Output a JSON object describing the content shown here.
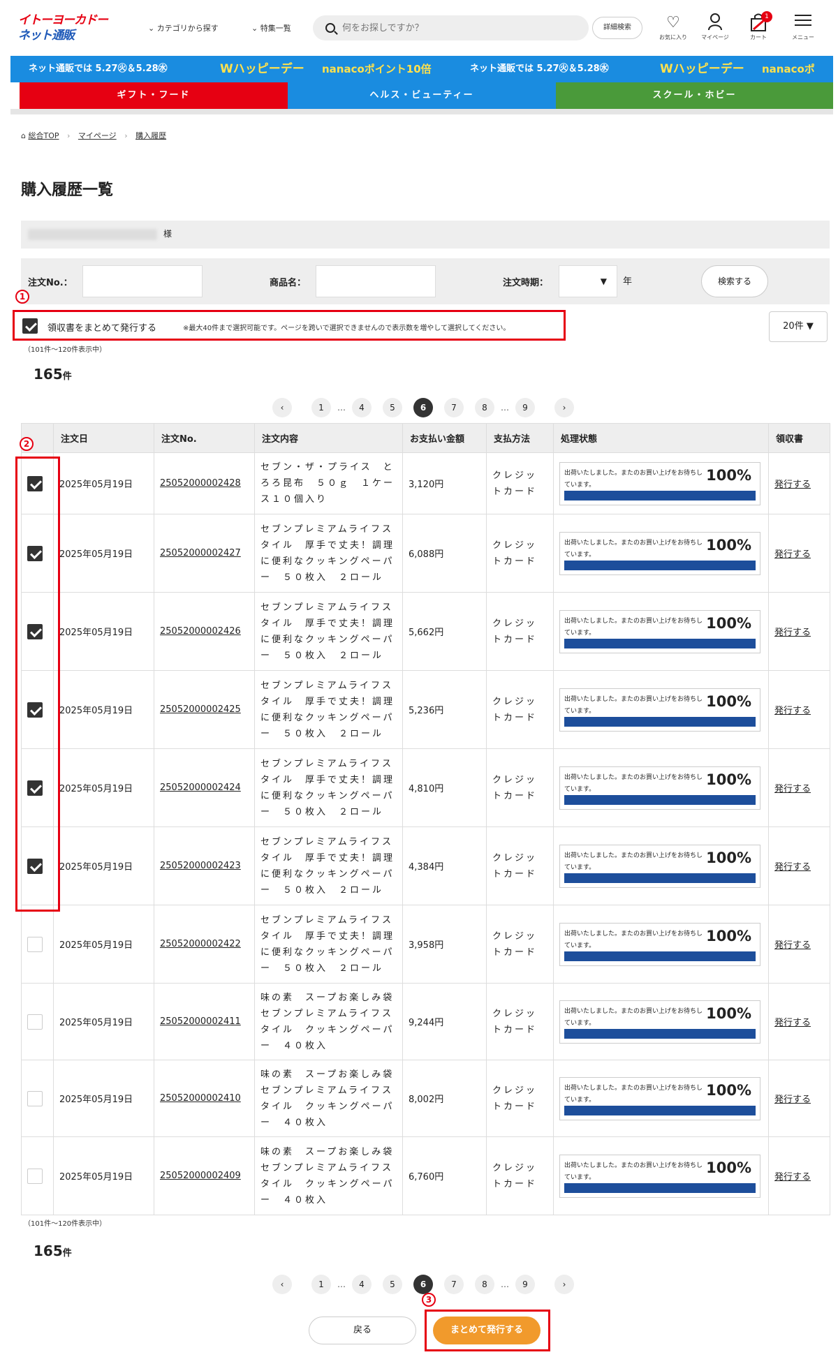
{
  "header": {
    "logo_line1": "イトーヨーカドー",
    "logo_line2": "ネット通販",
    "nav_category": "カテゴリから探す",
    "nav_feature": "特集一覧",
    "search_placeholder": "何をお探しですか？",
    "advanced_search": "詳細検索",
    "favorites": "お気に入り",
    "mypage": "マイページ",
    "cart": "カート",
    "cart_count": "1",
    "menu": "メニュー"
  },
  "banner": {
    "seg1": "ネット通販では 5.27㊋＆5.28㊌",
    "seg2": "Wハッピーデー",
    "seg3": "nanacoポイント10倍",
    "seg4": "ネット通販では 5.27㊋＆5.28㊌",
    "seg5": "Wハッピーデー",
    "seg6": "nanacoポ",
    "color": "#1a8ce0"
  },
  "categories": [
    {
      "label": "ギフト・フード",
      "color": "#e60012"
    },
    {
      "label": "ヘルス・ビューティー",
      "color": "#1a8ce0"
    },
    {
      "label": "スクール・ホビー",
      "color": "#4a9a3a"
    }
  ],
  "breadcrumb": {
    "home": "総合TOP",
    "mypage": "マイページ",
    "current": "購入履歴"
  },
  "page_title": "購入履歴一覧",
  "user_suffix": "様",
  "search_form": {
    "order_no_label": "注文No.：",
    "product_label": "商品名：",
    "period_label": "注文時期：",
    "year_label": "年",
    "select_arrow": "▼",
    "search_button": "検索する"
  },
  "annotations": {
    "n1": "1",
    "n2": "2",
    "n3": "3"
  },
  "bulk": {
    "label": "領収書をまとめて発行する",
    "note": "※最大40件まで選択可能です。ページを跨いで選択できませんので表示数を増やして選択してください。",
    "checked": true
  },
  "per_page": "20件 ▼",
  "range_text": "（101件〜120件表示中）",
  "total_count": "165",
  "count_unit": "件",
  "pagination": {
    "prev": "‹",
    "next": "›",
    "pages": [
      "1",
      "…",
      "4",
      "5",
      "6",
      "7",
      "8",
      "…",
      "9"
    ],
    "current": "6"
  },
  "table": {
    "headers": [
      "",
      "注文日",
      "注文No.",
      "注文内容",
      "お支払い金額",
      "支払方法",
      "処理状態",
      "領収書"
    ],
    "rows": [
      {
        "checked": true,
        "date": "2025年05月19日",
        "order_no": "25052000002428",
        "desc": "セブン・ザ・プライス　とろろ昆布　５０ｇ　１ケース１０個入り",
        "amount": "3,120円",
        "method": "クレジットカード",
        "status": "出荷いたしました。またのお買い上げをお待ちしています。",
        "progress": "100%",
        "progress_value": 100,
        "receipt": "発行する"
      },
      {
        "checked": true,
        "date": "2025年05月19日",
        "order_no": "25052000002427",
        "desc": "セブンプレミアムライフスタイル　厚手で丈夫！調理に便利なクッキングペーパー　５０枚入　２ロール",
        "amount": "6,088円",
        "method": "クレジットカード",
        "status": "出荷いたしました。またのお買い上げをお待ちしています。",
        "progress": "100%",
        "progress_value": 100,
        "receipt": "発行する"
      },
      {
        "checked": true,
        "date": "2025年05月19日",
        "order_no": "25052000002426",
        "desc": "セブンプレミアムライフスタイル　厚手で丈夫！調理に便利なクッキングペーパー　５０枚入　２ロール",
        "amount": "5,662円",
        "method": "クレジットカード",
        "status": "出荷いたしました。またのお買い上げをお待ちしています。",
        "progress": "100%",
        "progress_value": 100,
        "receipt": "発行する"
      },
      {
        "checked": true,
        "date": "2025年05月19日",
        "order_no": "25052000002425",
        "desc": "セブンプレミアムライフスタイル　厚手で丈夫！調理に便利なクッキングペーパー　５０枚入　２ロール",
        "amount": "5,236円",
        "method": "クレジットカード",
        "status": "出荷いたしました。またのお買い上げをお待ちしています。",
        "progress": "100%",
        "progress_value": 100,
        "receipt": "発行する"
      },
      {
        "checked": true,
        "date": "2025年05月19日",
        "order_no": "25052000002424",
        "desc": "セブンプレミアムライフスタイル　厚手で丈夫！調理に便利なクッキングペーパー　５０枚入　２ロール",
        "amount": "4,810円",
        "method": "クレジットカード",
        "status": "出荷いたしました。またのお買い上げをお待ちしています。",
        "progress": "100%",
        "progress_value": 100,
        "receipt": "発行する"
      },
      {
        "checked": true,
        "date": "2025年05月19日",
        "order_no": "25052000002423",
        "desc": "セブンプレミアムライフスタイル　厚手で丈夫！調理に便利なクッキングペーパー　５０枚入　２ロール",
        "amount": "4,384円",
        "method": "クレジットカード",
        "status": "出荷いたしました。またのお買い上げをお待ちしています。",
        "progress": "100%",
        "progress_value": 100,
        "receipt": "発行する"
      },
      {
        "checked": false,
        "date": "2025年05月19日",
        "order_no": "25052000002422",
        "desc": "セブンプレミアムライフスタイル　厚手で丈夫！調理に便利なクッキングペーパー　５０枚入　２ロール",
        "amount": "3,958円",
        "method": "クレジットカード",
        "status": "出荷いたしました。またのお買い上げをお待ちしています。",
        "progress": "100%",
        "progress_value": 100,
        "receipt": "発行する"
      },
      {
        "checked": false,
        "date": "2025年05月19日",
        "order_no": "25052000002411",
        "desc": "味の素　スープお楽しみ袋　セブンプレミアムライフスタイル　クッキングペーパー　４０枚入",
        "amount": "9,244円",
        "method": "クレジットカード",
        "status": "出荷いたしました。またのお買い上げをお待ちしています。",
        "progress": "100%",
        "progress_value": 100,
        "receipt": "発行する"
      },
      {
        "checked": false,
        "date": "2025年05月19日",
        "order_no": "25052000002410",
        "desc": "味の素　スープお楽しみ袋　セブンプレミアムライフスタイル　クッキングペーパー　４０枚入",
        "amount": "8,002円",
        "method": "クレジットカード",
        "status": "出荷いたしました。またのお買い上げをお待ちしています。",
        "progress": "100%",
        "progress_value": 100,
        "receipt": "発行する"
      },
      {
        "checked": false,
        "date": "2025年05月19日",
        "order_no": "25052000002409",
        "desc": "味の素　スープお楽しみ袋　セブンプレミアムライフスタイル　クッキングペーパー　４０枚入",
        "amount": "6,760円",
        "method": "クレジットカード",
        "status": "出荷いたしました。またのお買い上げをお待ちしています。",
        "progress": "100%",
        "progress_value": 100,
        "receipt": "発行する"
      }
    ]
  },
  "buttons": {
    "back": "戻る",
    "bulk_issue": "まとめて発行する"
  },
  "colors": {
    "accent_red": "#e60012",
    "progress_blue": "#1d4e9b",
    "bulk_orange": "#f19a2c"
  }
}
